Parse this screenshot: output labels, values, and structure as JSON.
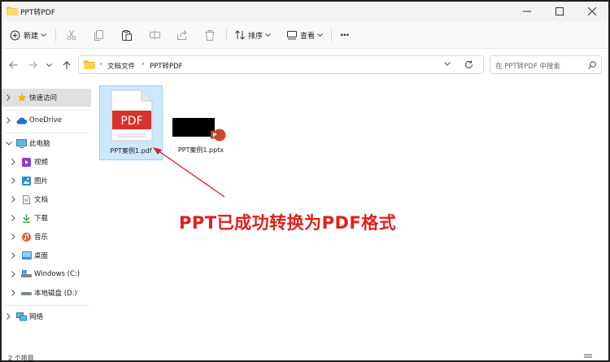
{
  "window": {
    "title": "PPT转PDF"
  },
  "toolbar": {
    "new_label": "新建",
    "sort_label": "排序",
    "view_label": "查看",
    "more_label": "···"
  },
  "address": {
    "crumbs": [
      "文档文件",
      "PPT转PDF"
    ],
    "search_placeholder": "在 PPT转PDF 中搜索"
  },
  "sidebar": {
    "items": [
      {
        "label": "快速访问",
        "icon": "star-icon"
      },
      {
        "label": "OneDrive",
        "icon": "cloud-icon"
      },
      {
        "label": "此电脑",
        "icon": "monitor-icon"
      },
      {
        "label": "视频",
        "icon": "video-icon"
      },
      {
        "label": "图片",
        "icon": "picture-icon"
      },
      {
        "label": "文档",
        "icon": "document-icon"
      },
      {
        "label": "下载",
        "icon": "download-icon"
      },
      {
        "label": "音乐",
        "icon": "music-icon"
      },
      {
        "label": "桌面",
        "icon": "desktop-icon"
      },
      {
        "label": "Windows (C:)",
        "icon": "drive-icon"
      },
      {
        "label": "本地磁盘 (D:)",
        "icon": "drive-icon"
      },
      {
        "label": "网络",
        "icon": "network-icon"
      }
    ]
  },
  "files": [
    {
      "name": "PPT案例1.pdf",
      "badge": "PDF",
      "type": "pdf"
    },
    {
      "name": "PPT案例1.pptx",
      "badge": "P",
      "type": "pptx"
    }
  ],
  "annotation": {
    "text": "PPT已成功转换为PDF格式"
  },
  "status": {
    "count": "2 个项目"
  },
  "colors": {
    "annotation": "#e0201c",
    "pdf_badge": "#d9312b",
    "selection": "#cce8ff",
    "ppt_orange": "#d24726"
  }
}
